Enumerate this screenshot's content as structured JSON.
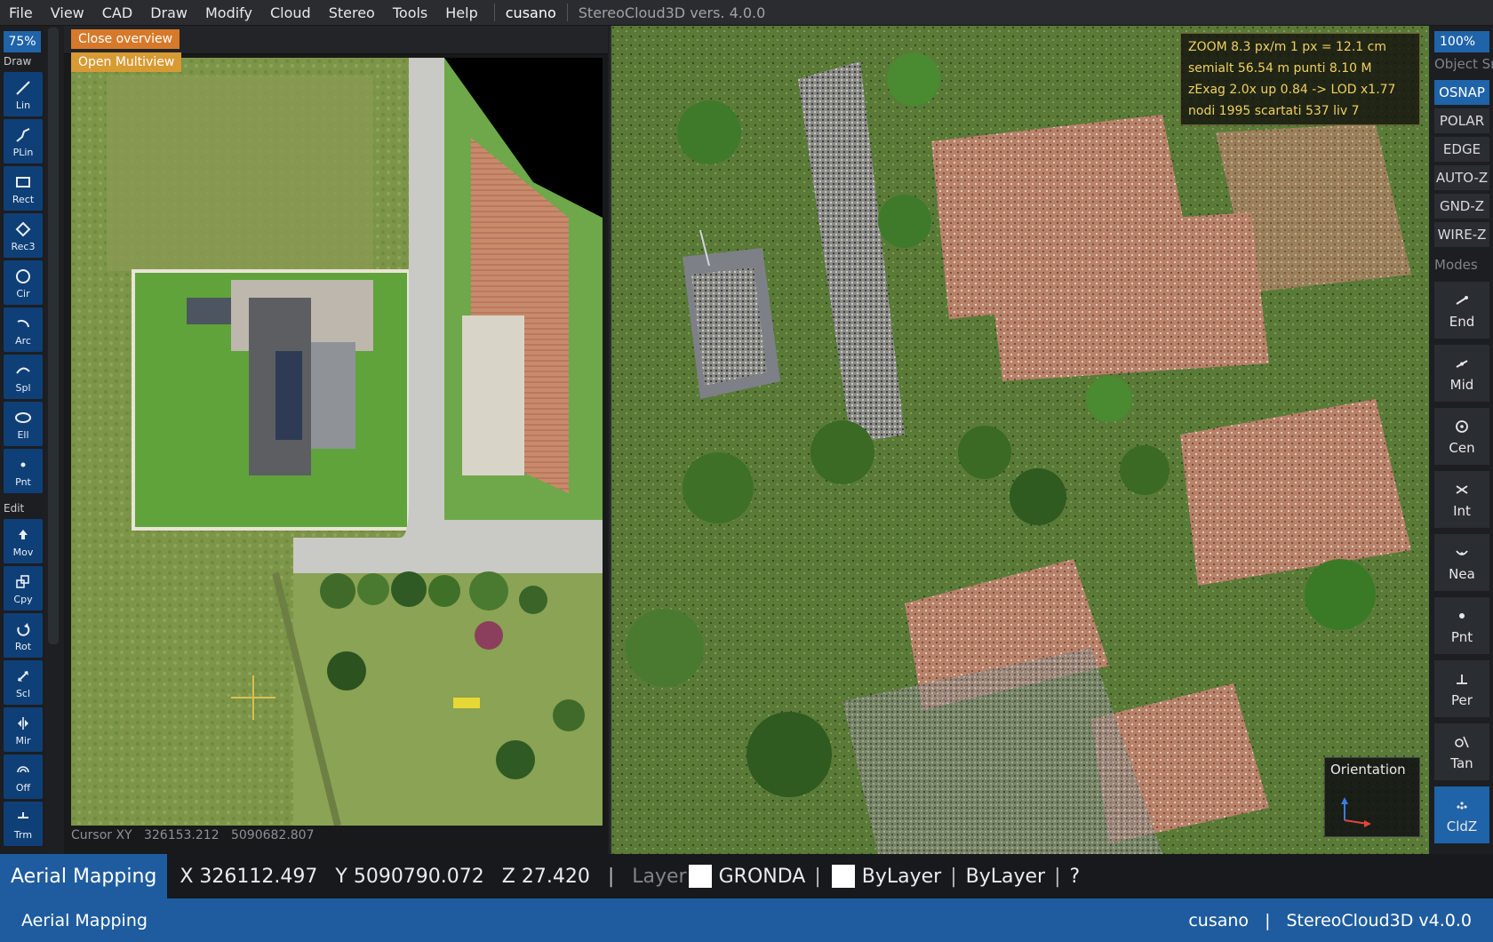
{
  "menubar": {
    "items": [
      "File",
      "View",
      "CAD",
      "Draw",
      "Modify",
      "Cloud",
      "Stereo",
      "Tools",
      "Help"
    ],
    "user": "cusano",
    "version": "StereoCloud3D vers. 4.0.0"
  },
  "left_toolbar": {
    "zoom": "75%",
    "draw_label": "Draw",
    "edit_label": "Edit",
    "draw_tools": [
      {
        "label": "Lin",
        "icon": "line-icon"
      },
      {
        "label": "PLin",
        "icon": "polyline-icon"
      },
      {
        "label": "Rect",
        "icon": "rectangle-icon"
      },
      {
        "label": "Rec3",
        "icon": "rect3-icon"
      },
      {
        "label": "Cir",
        "icon": "circle-icon"
      },
      {
        "label": "Arc",
        "icon": "arc-icon"
      },
      {
        "label": "Spl",
        "icon": "spline-icon"
      },
      {
        "label": "Ell",
        "icon": "ellipse-icon"
      },
      {
        "label": "Pnt",
        "icon": "point-icon"
      }
    ],
    "edit_tools": [
      {
        "label": "Mov",
        "icon": "move-icon"
      },
      {
        "label": "Cpy",
        "icon": "copy-icon"
      },
      {
        "label": "Rot",
        "icon": "rotate-icon"
      },
      {
        "label": "Scl",
        "icon": "scale-icon"
      },
      {
        "label": "Mir",
        "icon": "mirror-icon"
      },
      {
        "label": "Off",
        "icon": "offset-icon"
      },
      {
        "label": "Trm",
        "icon": "trim-icon"
      }
    ]
  },
  "overview": {
    "close_label": "Close overview",
    "multiview_label": "Open Multiview",
    "cursor_label": "Cursor XY",
    "cursor_x": "326153.212",
    "cursor_y": "5090682.807"
  },
  "viewport": {
    "info_lines": [
      "ZOOM  8.3 px/m   1 px = 12.1 cm",
      "semialt 56.54 m      punti 8.10 M",
      "zExag 2.0x  up 0.84  ->  LOD x1.77",
      "nodi 1995  scartati 537  liv 7"
    ],
    "orientation_label": "Orientation"
  },
  "right_toolbar": {
    "zoom": "100%",
    "object_snap_label": "Object Snap",
    "toggles": [
      {
        "label": "OSNAP",
        "on": true
      },
      {
        "label": "POLAR",
        "on": false
      },
      {
        "label": "EDGE",
        "on": false
      },
      {
        "label": "AUTO-Z",
        "on": false
      },
      {
        "label": "GND-Z",
        "on": false
      },
      {
        "label": "WIRE-Z",
        "on": false
      }
    ],
    "modes_label": "Modes",
    "snaps": [
      {
        "label": "End",
        "icon": "endpoint-icon",
        "on": false
      },
      {
        "label": "Mid",
        "icon": "midpoint-icon",
        "on": false
      },
      {
        "label": "Cen",
        "icon": "center-icon",
        "on": false
      },
      {
        "label": "Int",
        "icon": "intersection-icon",
        "on": false
      },
      {
        "label": "Nea",
        "icon": "nearest-icon",
        "on": false
      },
      {
        "label": "Pnt",
        "icon": "node-icon",
        "on": false
      },
      {
        "label": "Per",
        "icon": "perpendicular-icon",
        "on": false
      },
      {
        "label": "Tan",
        "icon": "tangent-icon",
        "on": false
      },
      {
        "label": "CldZ",
        "icon": "cloud-z-icon",
        "on": true
      }
    ]
  },
  "status": {
    "app_name": "Aerial Mapping",
    "x": "X 326112.497",
    "y": "Y 5090790.072",
    "z": "Z 27.420",
    "layer_label": "Layer",
    "layer_name": "GRONDA",
    "color_name": "ByLayer",
    "linetype": "ByLayer",
    "help": "?",
    "layer_swatch": "#ffffff"
  },
  "footer": {
    "app_name": "Aerial Mapping",
    "user": "cusano",
    "sep": "|",
    "version": "StereoCloud3D v4.0.0"
  },
  "colors": {
    "accent_blue": "#1f63a8",
    "overview_btn": "#d7792a",
    "info_text": "#f0d060"
  }
}
